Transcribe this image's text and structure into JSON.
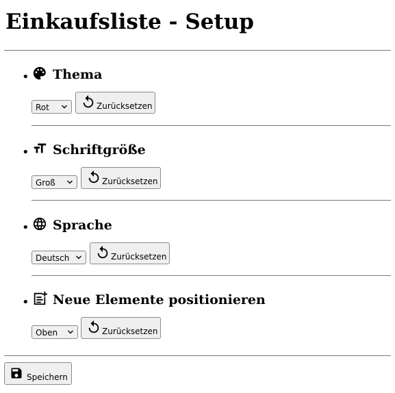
{
  "page": {
    "title": "Einkaufsliste - Setup"
  },
  "sections": [
    {
      "title": "Thema",
      "icon": "palette-icon",
      "selected": "Rot",
      "reset_label": "Zurücksetzen"
    },
    {
      "title": "Schriftgröße",
      "icon": "text-size-icon",
      "selected": "Groß",
      "reset_label": "Zurücksetzen"
    },
    {
      "title": "Sprache",
      "icon": "globe-icon",
      "selected": "Deutsch",
      "reset_label": "Zurücksetzen"
    },
    {
      "title": "Neue Elemente positionieren",
      "icon": "add-to-list-icon",
      "selected": "Oben",
      "reset_label": "Zurücksetzen"
    }
  ],
  "footer": {
    "save_label": "Speichern",
    "save_icon": "save-icon"
  }
}
